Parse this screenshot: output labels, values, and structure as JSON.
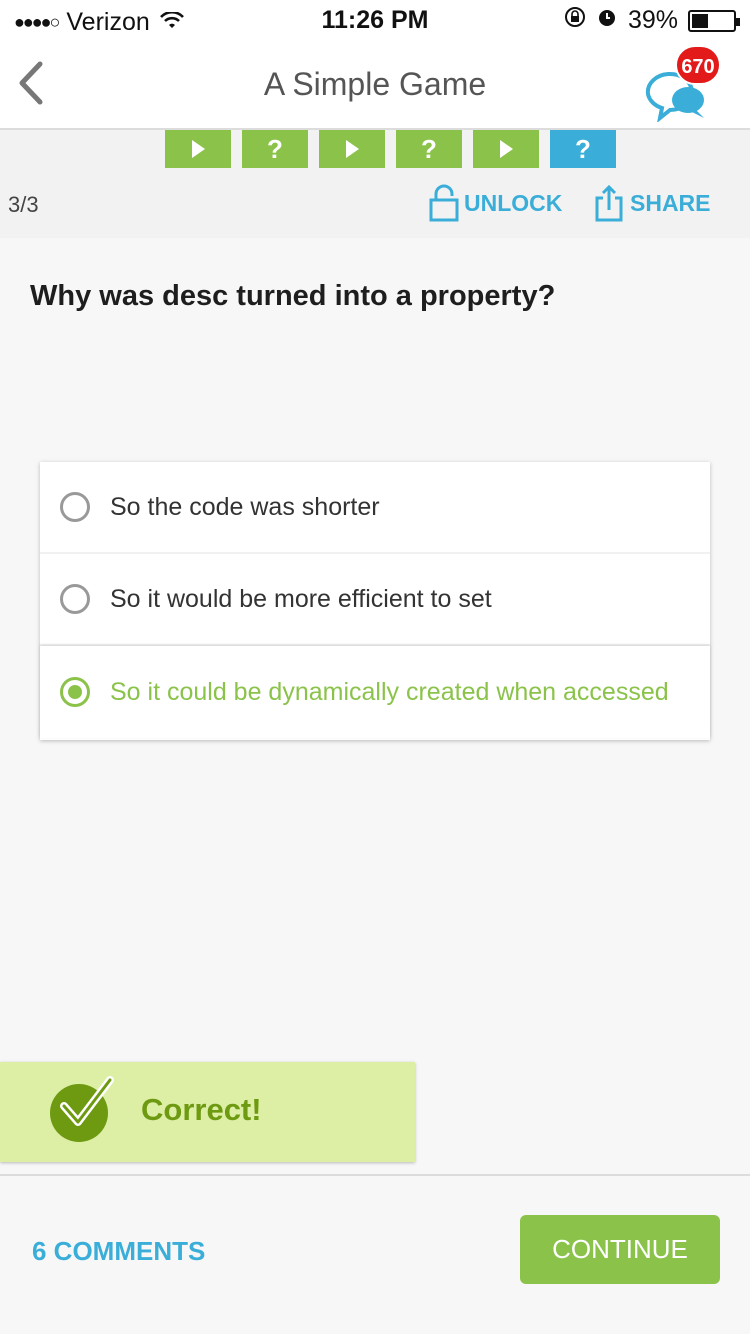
{
  "status_bar": {
    "carrier": "Verizon",
    "time": "11:26 PM",
    "battery_percent": "39%",
    "battery_level": 0.39
  },
  "nav": {
    "title": "A Simple Game",
    "badge_count": "670"
  },
  "steps": [
    {
      "type": "play",
      "icon": "play-icon"
    },
    {
      "type": "question",
      "label": "?"
    },
    {
      "type": "play",
      "icon": "play-icon"
    },
    {
      "type": "question",
      "label": "?"
    },
    {
      "type": "play",
      "icon": "play-icon"
    },
    {
      "type": "question",
      "label": "?",
      "current": true
    }
  ],
  "toolbar": {
    "counter": "3/3",
    "unlock_label": "UNLOCK",
    "share_label": "SHARE"
  },
  "question": {
    "text": "Why was desc turned into a property?"
  },
  "options": [
    {
      "label": "So the code was shorter",
      "selected": false
    },
    {
      "label": "So it would be more efficient to set",
      "selected": false
    },
    {
      "label": "So it could be dynamically created when accessed",
      "selected": true
    }
  ],
  "feedback": {
    "text": "Correct!"
  },
  "footer": {
    "comments_label": "6 COMMENTS",
    "continue_label": "CONTINUE"
  },
  "colors": {
    "accent_green": "#8bc34a",
    "accent_blue": "#3aaed8",
    "badge_red": "#e21a1a",
    "feedback_bg": "#ddeea5"
  }
}
